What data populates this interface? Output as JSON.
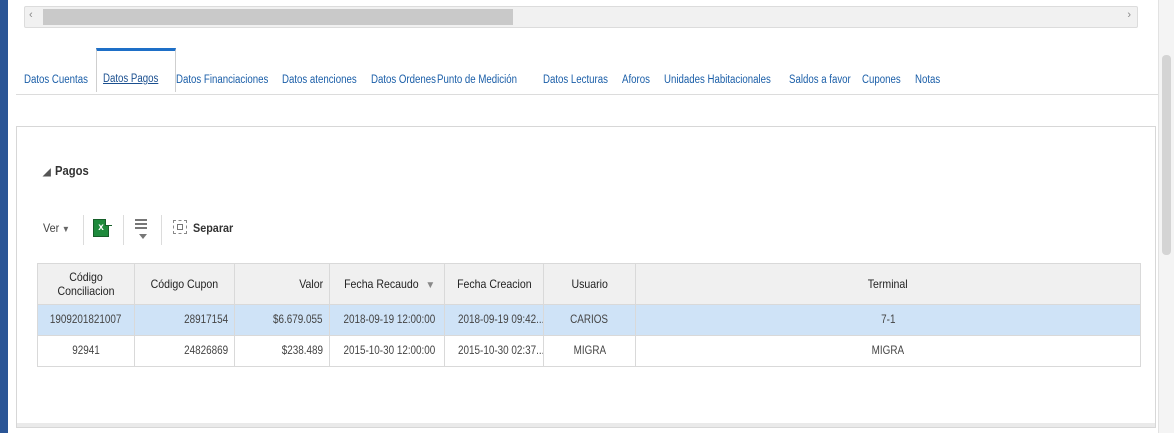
{
  "tabs": [
    {
      "label": "Datos Cuentas"
    },
    {
      "label": "Datos Pagos",
      "active": true
    },
    {
      "label": "Datos Financiaciones"
    },
    {
      "label": "Datos atenciones"
    },
    {
      "label": "Datos Ordenes"
    },
    {
      "label": "Punto de Medición"
    },
    {
      "label": "Datos Lecturas"
    },
    {
      "label": "Aforos"
    },
    {
      "label": "Unidades Habitacionales"
    },
    {
      "label": "Saldos a favor"
    },
    {
      "label": "Cupones"
    },
    {
      "label": "Notas"
    }
  ],
  "section": {
    "title": "Pagos",
    "collapse_icon": "triangle-expanded-icon"
  },
  "toolbar": {
    "view_label": "Ver",
    "export_icon": "excel-export-icon",
    "freeze_icon": "freeze-column-icon",
    "detach_label": "Separar",
    "detach_icon": "detach-icon"
  },
  "table": {
    "columns": [
      {
        "label": "Código Conciliacion"
      },
      {
        "label": "Código Cupon"
      },
      {
        "label": "Valor"
      },
      {
        "label": "Fecha Recaudo",
        "sorted": "desc"
      },
      {
        "label": "Fecha Creacion"
      },
      {
        "label": "Usuario"
      },
      {
        "label": "Terminal"
      }
    ],
    "rows": [
      {
        "cells": [
          "1909201821007",
          "28917154",
          "$6.679.055",
          "2018-09-19 12:00:00",
          "2018-09-19 09:42...",
          "CARIOS",
          "7-1"
        ],
        "selected": true
      },
      {
        "cells": [
          "92941",
          "24826869",
          "$238.489",
          "2015-10-30 12:00:00",
          "2015-10-30 02:37...",
          "MIGRA",
          "MIGRA"
        ],
        "selected": false
      }
    ]
  },
  "colors": {
    "accent": "#1e6fc7",
    "selected_row": "#cfe3f7",
    "link": "#1a5ea8"
  }
}
